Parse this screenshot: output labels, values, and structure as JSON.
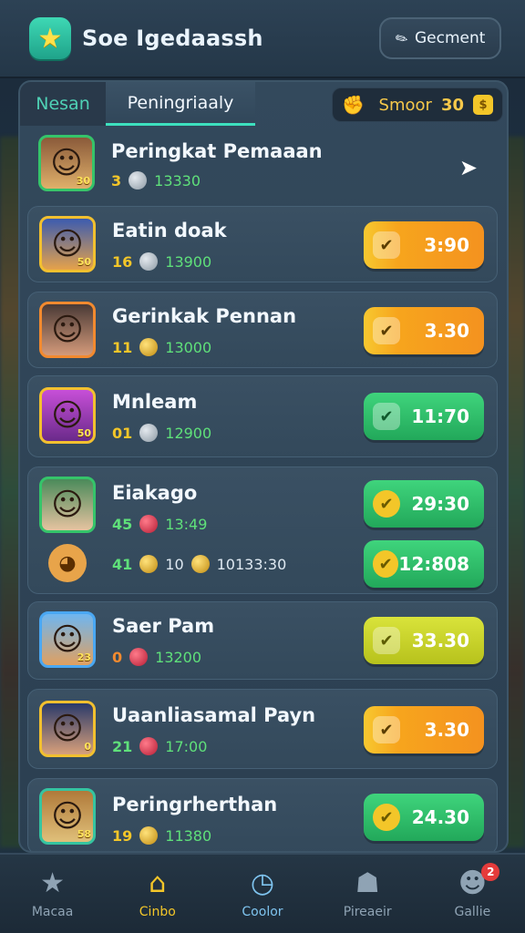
{
  "header": {
    "title": "Soe Igedaassh",
    "button_label": "Gecment",
    "button_icon": "pencil-icon",
    "app_icon": "star-icon"
  },
  "tabs": [
    {
      "label": "Nesan",
      "active": false
    },
    {
      "label": "Peningriaaly",
      "active": true
    }
  ],
  "score_chip": {
    "label": "Smoor",
    "value": "30"
  },
  "rows": [
    {
      "name": "Peringkat Pemaaan",
      "level": "3",
      "points": "13330",
      "avatar_badge": "30",
      "border": "#35c46a"
    },
    {
      "name": "Eatin doak",
      "level": "16",
      "points": "13900",
      "avatar_badge": "50",
      "border": "#f2c02f",
      "pill": {
        "value": "3:90",
        "style": "orange"
      }
    },
    {
      "name": "Gerinkak Pennan",
      "level": "11",
      "points": "13000",
      "avatar_badge": "",
      "border": "#f28a2f",
      "pill": {
        "value": "3.30",
        "style": "orange"
      }
    },
    {
      "name": "Mnleam",
      "level": "01",
      "points": "12900",
      "avatar_badge": "50",
      "border": "#f2c02f",
      "pill": {
        "value": "11:70",
        "style": "green"
      }
    },
    {
      "name": "Eiakago",
      "level": "45",
      "points": "13:49",
      "avatar_badge": "",
      "border": "#35c46a",
      "pill": {
        "value": "29:30",
        "style": "green"
      },
      "sub": {
        "level": "41",
        "count": "10",
        "points": "10133:30",
        "pill": "12:808"
      }
    },
    {
      "name": "Saer Pam",
      "level": "0",
      "points": "13200",
      "avatar_badge": "23",
      "border": "#4aa7f2",
      "pill": {
        "value": "33.30",
        "style": "lime"
      }
    },
    {
      "name": "Uaanliasamal Payn",
      "level": "21",
      "points": "17:00",
      "avatar_badge": "0",
      "border": "#f2c02f",
      "pill": {
        "value": "3.30",
        "style": "orange"
      }
    },
    {
      "name": "Peringrherthan",
      "level": "19",
      "points": "11380",
      "avatar_badge": "58",
      "border": "#35c4a0",
      "pill": {
        "value": "24.30",
        "style": "green"
      }
    }
  ],
  "bottom_nav": [
    {
      "label": "Macaa",
      "icon": "star-icon"
    },
    {
      "label": "Cinbo",
      "icon": "home-icon",
      "active": true
    },
    {
      "label": "Coolor",
      "icon": "clock-icon"
    },
    {
      "label": "Pireaeir",
      "icon": "group-icon"
    },
    {
      "label": "Gallie",
      "icon": "user-icon",
      "badge": "2"
    }
  ],
  "colors": {
    "accent": "#3de0be",
    "gold": "#f3c629",
    "points_green": "#5fe07a"
  }
}
